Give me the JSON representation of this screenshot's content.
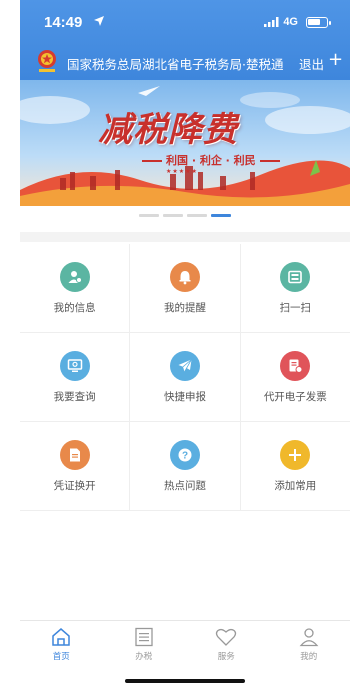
{
  "status": {
    "time": "14:49",
    "network": "4G"
  },
  "header": {
    "title": "国家税务总局湖北省电子税务局·楚税通",
    "logout": "退出",
    "plus": "+"
  },
  "banner": {
    "title": "减税降费",
    "subtitle": "利国 · 利企 · 利民",
    "stars": "★★★★★",
    "slide_count": 4,
    "active_slide": 4
  },
  "grid": {
    "items": [
      {
        "label": "我的信息",
        "icon": "user-info-icon",
        "color": "#5bb5a2"
      },
      {
        "label": "我的提醒",
        "icon": "bell-icon",
        "color": "#e8894a"
      },
      {
        "label": "扫一扫",
        "icon": "scan-icon",
        "color": "#5bb5a2"
      },
      {
        "label": "我要查询",
        "icon": "monitor-search-icon",
        "color": "#5aaee0"
      },
      {
        "label": "快捷申报",
        "icon": "paper-plane-icon",
        "color": "#5aaee0"
      },
      {
        "label": "代开电子发票",
        "icon": "invoice-icon",
        "color": "#e0545a"
      },
      {
        "label": "凭证换开",
        "icon": "document-icon",
        "color": "#e8894a"
      },
      {
        "label": "热点问题",
        "icon": "question-icon",
        "color": "#5aaee0"
      },
      {
        "label": "添加常用",
        "icon": "add-icon",
        "color": "#f0b82b"
      }
    ]
  },
  "tabs": [
    {
      "label": "首页",
      "icon": "home-icon",
      "active": true
    },
    {
      "label": "办税",
      "icon": "list-icon",
      "active": false
    },
    {
      "label": "服务",
      "icon": "heart-icon",
      "active": false
    },
    {
      "label": "我的",
      "icon": "person-icon",
      "active": false
    }
  ],
  "colors": {
    "primary": "#3e86dc",
    "banner_red": "#c8302c"
  }
}
